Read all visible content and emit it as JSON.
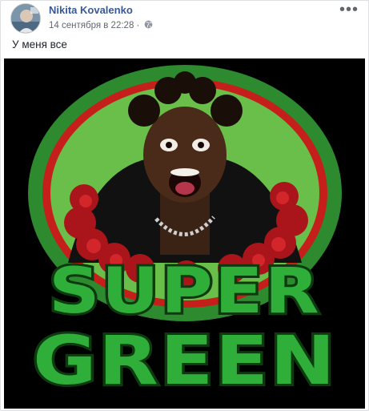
{
  "post": {
    "author": "Nikita Kovalenko",
    "timestamp": "14 сентября в 22:28",
    "separator": "·",
    "privacy_icon": "globe-icon",
    "more_icon": "more-options-icon",
    "text": "У меня все"
  },
  "image": {
    "line1": "SUPER",
    "line2": "GREEN",
    "colors": {
      "background": "#000000",
      "outer_green": "#2d8a2f",
      "red_ring": "#c41f1a",
      "inner_green": "#6abf4b",
      "letter_fill": "#2fae3a",
      "letter_outline": "#0d3a0f"
    }
  }
}
